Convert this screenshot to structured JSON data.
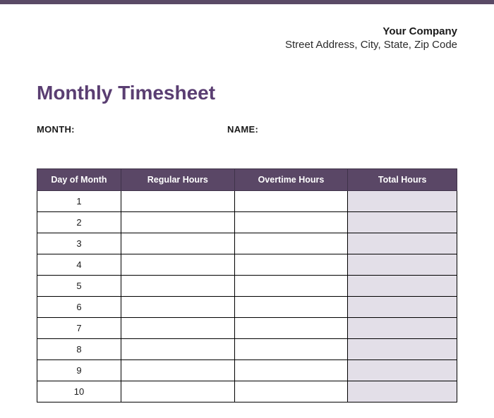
{
  "header": {
    "company_name": "Your Company",
    "company_address": "Street Address, City, State, Zip Code"
  },
  "title": "Monthly Timesheet",
  "meta": {
    "month_label": "MONTH:",
    "name_label": "NAME:"
  },
  "table": {
    "headers": {
      "day": "Day of Month",
      "regular": "Regular Hours",
      "overtime": "Overtime Hours",
      "total": "Total Hours"
    },
    "rows": [
      {
        "day": "1",
        "regular": "",
        "overtime": "",
        "total": ""
      },
      {
        "day": "2",
        "regular": "",
        "overtime": "",
        "total": ""
      },
      {
        "day": "3",
        "regular": "",
        "overtime": "",
        "total": ""
      },
      {
        "day": "4",
        "regular": "",
        "overtime": "",
        "total": ""
      },
      {
        "day": "5",
        "regular": "",
        "overtime": "",
        "total": ""
      },
      {
        "day": "6",
        "regular": "",
        "overtime": "",
        "total": ""
      },
      {
        "day": "7",
        "regular": "",
        "overtime": "",
        "total": ""
      },
      {
        "day": "8",
        "regular": "",
        "overtime": "",
        "total": ""
      },
      {
        "day": "9",
        "regular": "",
        "overtime": "",
        "total": ""
      },
      {
        "day": "10",
        "regular": "",
        "overtime": "",
        "total": ""
      }
    ]
  }
}
